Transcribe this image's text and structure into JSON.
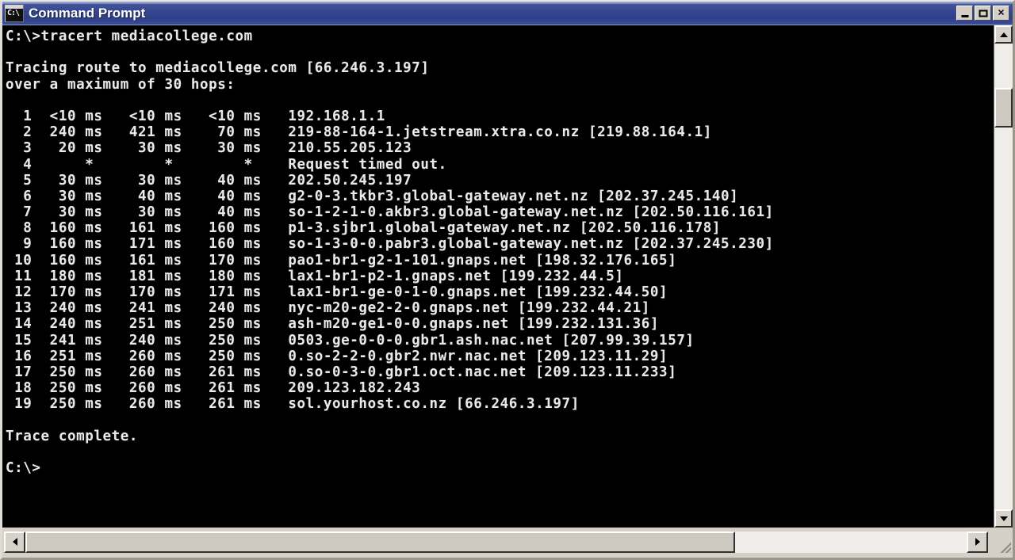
{
  "window": {
    "title": "Command Prompt",
    "icon": "cmd-icon",
    "icon_text": "C:\\",
    "buttons": {
      "minimize": "minimize-button",
      "maximize": "maximize-button",
      "close_label": "✕"
    },
    "titlebar_color": "#36468f",
    "console_bg": "#000000",
    "console_fg": "#e9e9e9"
  },
  "scrollbars": {
    "vertical": {
      "up_arrow": "scroll-up-arrow",
      "down_arrow": "scroll-down-arrow"
    },
    "horizontal": {
      "left_arrow": "scroll-left-arrow",
      "right_arrow": "scroll-right-arrow"
    }
  },
  "console": {
    "prompt": "C:\\>",
    "command": "tracert mediacollege.com",
    "command_line": "C:\\>tracert mediacollege.com",
    "header": [
      "Tracing route to mediacollege.com [66.246.3.197]",
      "over a maximum of 30 hops:"
    ],
    "hops": [
      {
        "n": "1",
        "rtt1": "<10 ms",
        "rtt2": "<10 ms",
        "rtt3": "<10 ms",
        "host": "192.168.1.1"
      },
      {
        "n": "2",
        "rtt1": "240 ms",
        "rtt2": "421 ms",
        "rtt3": "70 ms",
        "host": "219-88-164-1.jetstream.xtra.co.nz [219.88.164.1]"
      },
      {
        "n": "3",
        "rtt1": "20 ms",
        "rtt2": "30 ms",
        "rtt3": "30 ms",
        "host": "210.55.205.123"
      },
      {
        "n": "4",
        "rtt1": "*",
        "rtt2": "*",
        "rtt3": "*",
        "host": "Request timed out."
      },
      {
        "n": "5",
        "rtt1": "30 ms",
        "rtt2": "30 ms",
        "rtt3": "40 ms",
        "host": "202.50.245.197"
      },
      {
        "n": "6",
        "rtt1": "30 ms",
        "rtt2": "40 ms",
        "rtt3": "40 ms",
        "host": "g2-0-3.tkbr3.global-gateway.net.nz [202.37.245.140]"
      },
      {
        "n": "7",
        "rtt1": "30 ms",
        "rtt2": "30 ms",
        "rtt3": "40 ms",
        "host": "so-1-2-1-0.akbr3.global-gateway.net.nz [202.50.116.161]"
      },
      {
        "n": "8",
        "rtt1": "160 ms",
        "rtt2": "161 ms",
        "rtt3": "160 ms",
        "host": "p1-3.sjbr1.global-gateway.net.nz [202.50.116.178]"
      },
      {
        "n": "9",
        "rtt1": "160 ms",
        "rtt2": "171 ms",
        "rtt3": "160 ms",
        "host": "so-1-3-0-0.pabr3.global-gateway.net.nz [202.37.245.230]"
      },
      {
        "n": "10",
        "rtt1": "160 ms",
        "rtt2": "161 ms",
        "rtt3": "170 ms",
        "host": "pao1-br1-g2-1-101.gnaps.net [198.32.176.165]"
      },
      {
        "n": "11",
        "rtt1": "180 ms",
        "rtt2": "181 ms",
        "rtt3": "180 ms",
        "host": "lax1-br1-p2-1.gnaps.net [199.232.44.5]"
      },
      {
        "n": "12",
        "rtt1": "170 ms",
        "rtt2": "170 ms",
        "rtt3": "171 ms",
        "host": "lax1-br1-ge-0-1-0.gnaps.net [199.232.44.50]"
      },
      {
        "n": "13",
        "rtt1": "240 ms",
        "rtt2": "241 ms",
        "rtt3": "240 ms",
        "host": "nyc-m20-ge2-2-0.gnaps.net [199.232.44.21]"
      },
      {
        "n": "14",
        "rtt1": "240 ms",
        "rtt2": "251 ms",
        "rtt3": "250 ms",
        "host": "ash-m20-ge1-0-0.gnaps.net [199.232.131.36]"
      },
      {
        "n": "15",
        "rtt1": "241 ms",
        "rtt2": "240 ms",
        "rtt3": "250 ms",
        "host": "0503.ge-0-0-0.gbr1.ash.nac.net [207.99.39.157]"
      },
      {
        "n": "16",
        "rtt1": "251 ms",
        "rtt2": "260 ms",
        "rtt3": "250 ms",
        "host": "0.so-2-2-0.gbr2.nwr.nac.net [209.123.11.29]"
      },
      {
        "n": "17",
        "rtt1": "250 ms",
        "rtt2": "260 ms",
        "rtt3": "261 ms",
        "host": "0.so-0-3-0.gbr1.oct.nac.net [209.123.11.233]"
      },
      {
        "n": "18",
        "rtt1": "250 ms",
        "rtt2": "260 ms",
        "rtt3": "261 ms",
        "host": "209.123.182.243"
      },
      {
        "n": "19",
        "rtt1": "250 ms",
        "rtt2": "260 ms",
        "rtt3": "261 ms",
        "host": "sol.yourhost.co.nz [66.246.3.197]"
      }
    ],
    "footer": "Trace complete.",
    "final_prompt": "C:\\>"
  }
}
